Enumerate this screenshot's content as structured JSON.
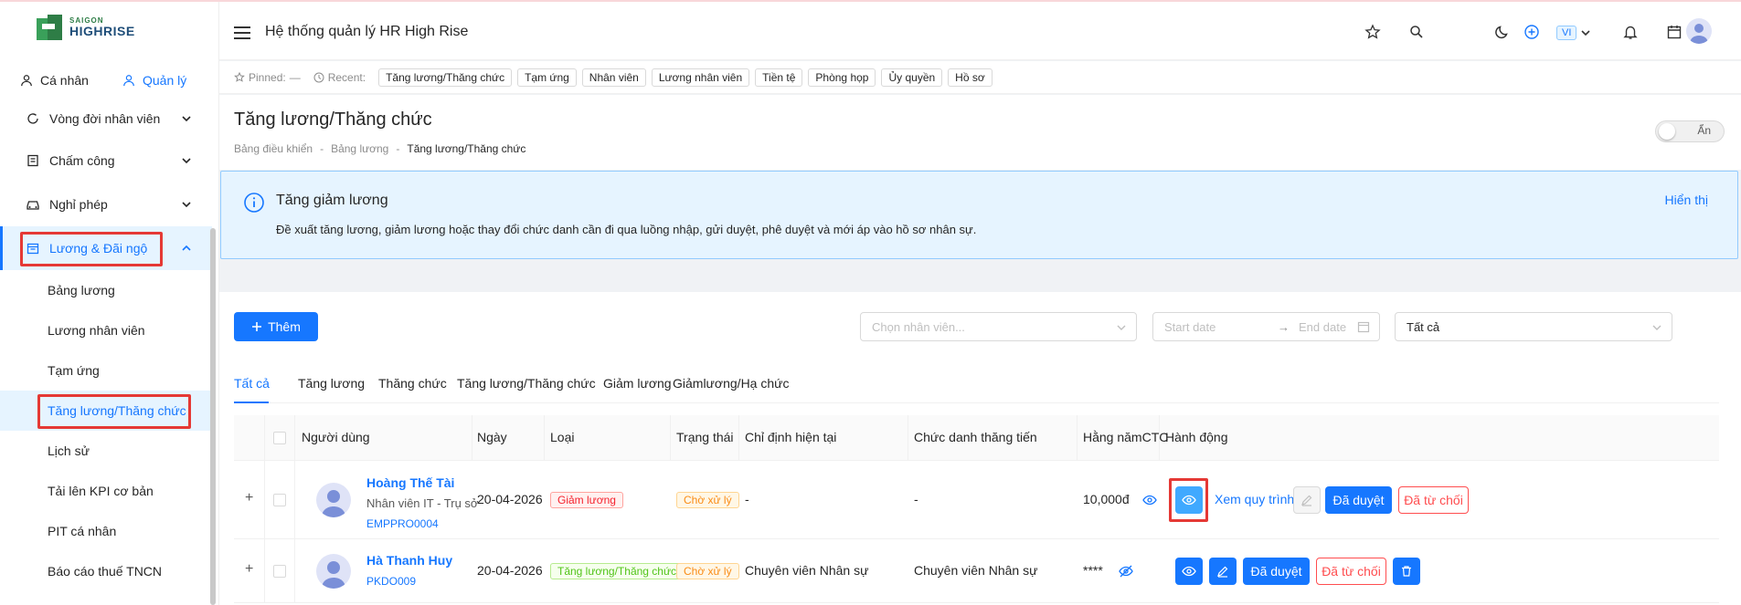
{
  "brand": {
    "line1": "SAIGON",
    "line2": "HIGHRISE"
  },
  "sidebar": {
    "tabs": [
      {
        "label": "Cá nhân"
      },
      {
        "label": "Quản lý"
      }
    ],
    "menu": [
      {
        "label": "Vòng đời nhân viên"
      },
      {
        "label": "Chấm công"
      },
      {
        "label": "Nghỉ phép"
      },
      {
        "label": "Lương & Đãi ngộ"
      }
    ],
    "submenu": [
      {
        "label": "Bảng lương"
      },
      {
        "label": "Lương nhân viên"
      },
      {
        "label": "Tạm ứng"
      },
      {
        "label": "Tăng lương/Thăng chức"
      },
      {
        "label": "Lịch sử"
      },
      {
        "label": "Tải lên KPI cơ bản"
      },
      {
        "label": "PIT cá nhân"
      },
      {
        "label": "Báo cáo thuế TNCN"
      }
    ]
  },
  "header": {
    "title": "Hệ thống quản lý HR High Rise",
    "lang": "VI"
  },
  "recent": {
    "pinned_label": "Pinned:",
    "pinned_value": "—",
    "recent_label": "Recent:",
    "items": [
      "Tăng lương/Thăng chức",
      "Tạm ứng",
      "Nhân viên",
      "Lương nhân viên",
      "Tiền tệ",
      "Phòng họp",
      "Ủy quyền",
      "Hồ sơ"
    ]
  },
  "page": {
    "title": "Tăng lương/Thăng chức",
    "breadcrumb": [
      "Bảng điều khiển",
      "Bảng lương",
      "Tăng lương/Thăng chức"
    ],
    "toggle_label": "Ẩn"
  },
  "alert": {
    "title": "Tăng giảm lương",
    "description": "Đề xuất tăng lương, giảm lương hoặc thay đổi chức danh cần đi qua luồng nhập, gửi duyệt, phê duyệt và mới áp vào hồ sơ nhân sự.",
    "link": "Hiển thị"
  },
  "toolbar": {
    "add_label": "Thêm",
    "employee_placeholder": "Chọn nhân viên...",
    "start_date": "Start date",
    "end_date": "End date",
    "status_value": "Tất cả"
  },
  "tabs": [
    "Tất cả",
    "Tăng lương",
    "Thăng chức",
    "Tăng lương/Thăng chức",
    "Giảm lương",
    "Giảmlương/Hạ chức"
  ],
  "table": {
    "headers": [
      "Người dùng",
      "Ngày",
      "Loại",
      "Trạng thái",
      "Chỉ định hiện tại",
      "Chức danh thăng tiến",
      "Hằng nămCTC",
      "Hành động"
    ],
    "rows": [
      {
        "name": "Hoàng Thế Tài",
        "subtitle": "Nhân viên IT - Trụ sở",
        "code": "EMPPRO0004",
        "date": "20-04-2026",
        "type": "Giảm lương",
        "status": "Chờ xử lý",
        "current": "-",
        "promotion": "-",
        "ctc": "10,000đ",
        "view_flow": "Xem quy trình",
        "approve": "Đã duyệt",
        "reject": "Đã từ chối"
      },
      {
        "name": "Hà Thanh Huy",
        "subtitle": "",
        "code": "PKDO009",
        "date": "20-04-2026",
        "type": "Tăng lương/Thăng chức",
        "status": "Chờ xử lý",
        "current": "Chuyên viên Nhân sự",
        "promotion": "Chuyên viên Nhân sự",
        "ctc": "****",
        "approve": "Đã duyệt",
        "reject": "Đã từ chối"
      }
    ]
  }
}
